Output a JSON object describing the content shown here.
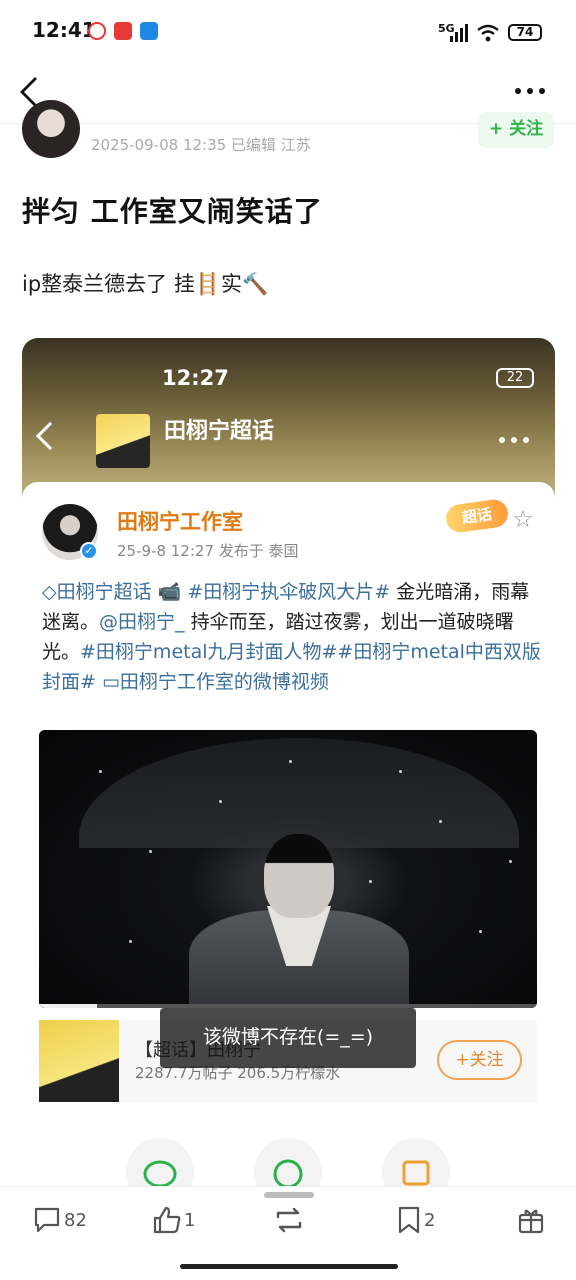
{
  "status_bar": {
    "time": "12:41",
    "signal": "5G",
    "battery": "74"
  },
  "post": {
    "meta": "2025-09-08 12:35  已编辑  江苏",
    "follow_label": "+ 关注",
    "title": "拌匀 工作室又闹笑话了",
    "body": "ip整泰兰德去了  挂🪜实🔨"
  },
  "embedded": {
    "status_time": "12:27",
    "status_battery": "22",
    "page_title": "田栩宁超话",
    "author_name": "田栩宁工作室",
    "author_meta": "25-9-8 12:27  发布于 泰国",
    "badge": "超话",
    "text": {
      "t1": "◇田栩宁超话",
      "t2": " 📹 ",
      "t3": "#田栩宁执伞破风大片#",
      "t4": " 金光暗涌，雨幕迷离。",
      "t5": "@田栩宁_",
      "t6": " 持伞而至，踏过夜雾，划出一道破晓曙光。",
      "t7": "#田栩宁metal九月封面人物##田栩宁metal中西双版封面#",
      "t8": " ▭田栩宁工作室的微博视频"
    },
    "supertopic_title": "【超话】田栩宁",
    "supertopic_meta": "2287.7万帖子 206.5万柠檬水",
    "supertopic_follow": "+关注",
    "toast": "该微博不存在(=_=)"
  },
  "actions": {
    "comments": "82",
    "likes": "1",
    "bookmarks": "2"
  }
}
